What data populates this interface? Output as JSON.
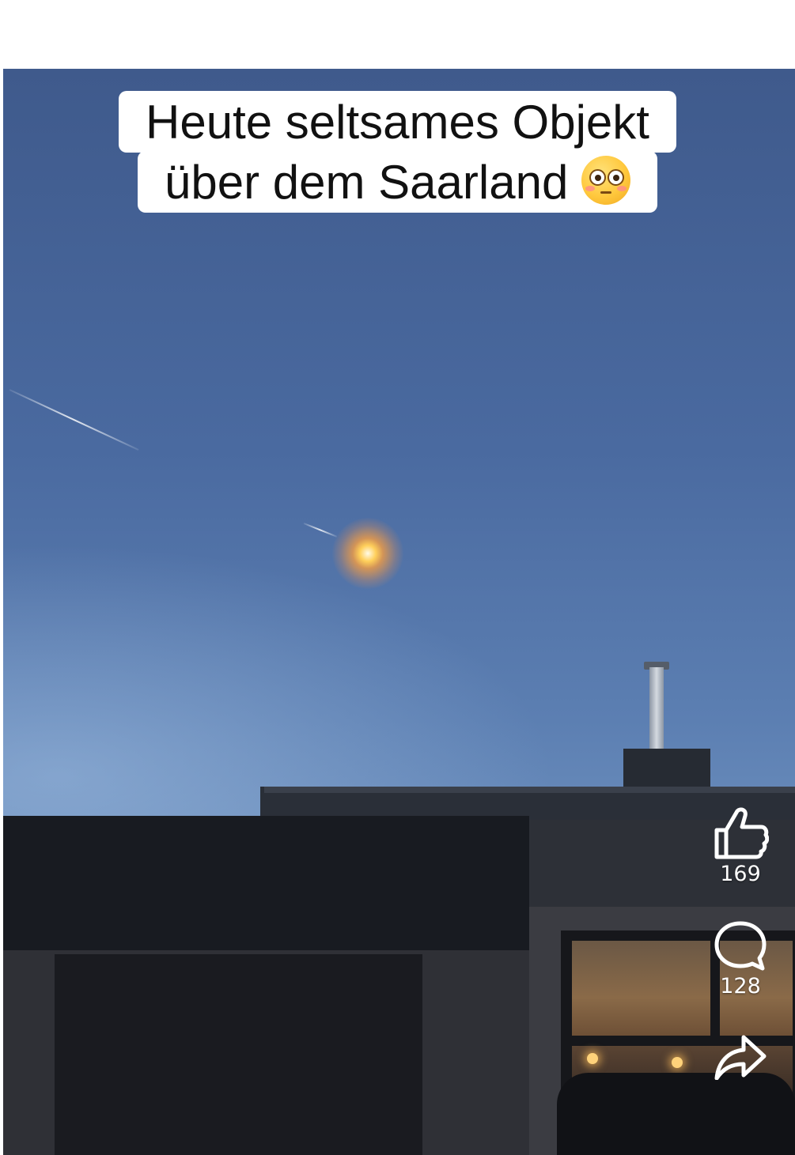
{
  "caption": {
    "line1": "Heute seltsames Objekt",
    "line2": "über dem Saarland",
    "emoji": "flushed-face-emoji"
  },
  "actions": {
    "like": {
      "icon": "thumbs-up-icon",
      "count": "169"
    },
    "comment": {
      "icon": "comment-bubble-icon",
      "count": "128"
    },
    "share": {
      "icon": "share-arrow-icon"
    }
  },
  "colors": {
    "sky_top": "#3f5a8c",
    "sky_bottom": "#88a6cc",
    "fireball": "#ffcf5a",
    "caption_bg": "#ffffff",
    "caption_text": "#111111"
  }
}
